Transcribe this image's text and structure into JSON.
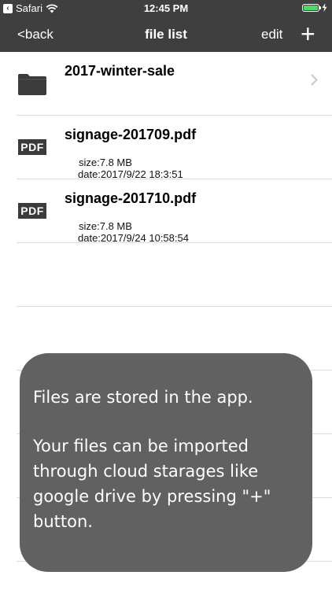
{
  "status_bar": {
    "back_app": "Safari",
    "time": "12:45 PM"
  },
  "nav": {
    "back_label": "<back",
    "title": "file list",
    "edit_label": "edit",
    "add_label": "+"
  },
  "files": [
    {
      "name": "2017-winter-sale",
      "type": "folder"
    },
    {
      "name": "signage-201709.pdf",
      "type": "pdf",
      "icon_label": "PDF",
      "size": "size:7.8 MB",
      "date": "date:2017/9/22 18:3:51"
    },
    {
      "name": "signage-201710.pdf",
      "type": "pdf",
      "icon_label": "PDF",
      "size": "size:7.8 MB",
      "date": "date:2017/9/24 10:58:54"
    }
  ],
  "overlay": {
    "line1": "Files are stored in the app.",
    "line2": "Your files can be imported",
    "line3": "through cloud starages like",
    "line4": "google drive by pressing \"+\"",
    "line5": "button."
  },
  "colors": {
    "bar": "#3f3f3f",
    "overlay": "#616161",
    "battery": "#4cd964"
  }
}
